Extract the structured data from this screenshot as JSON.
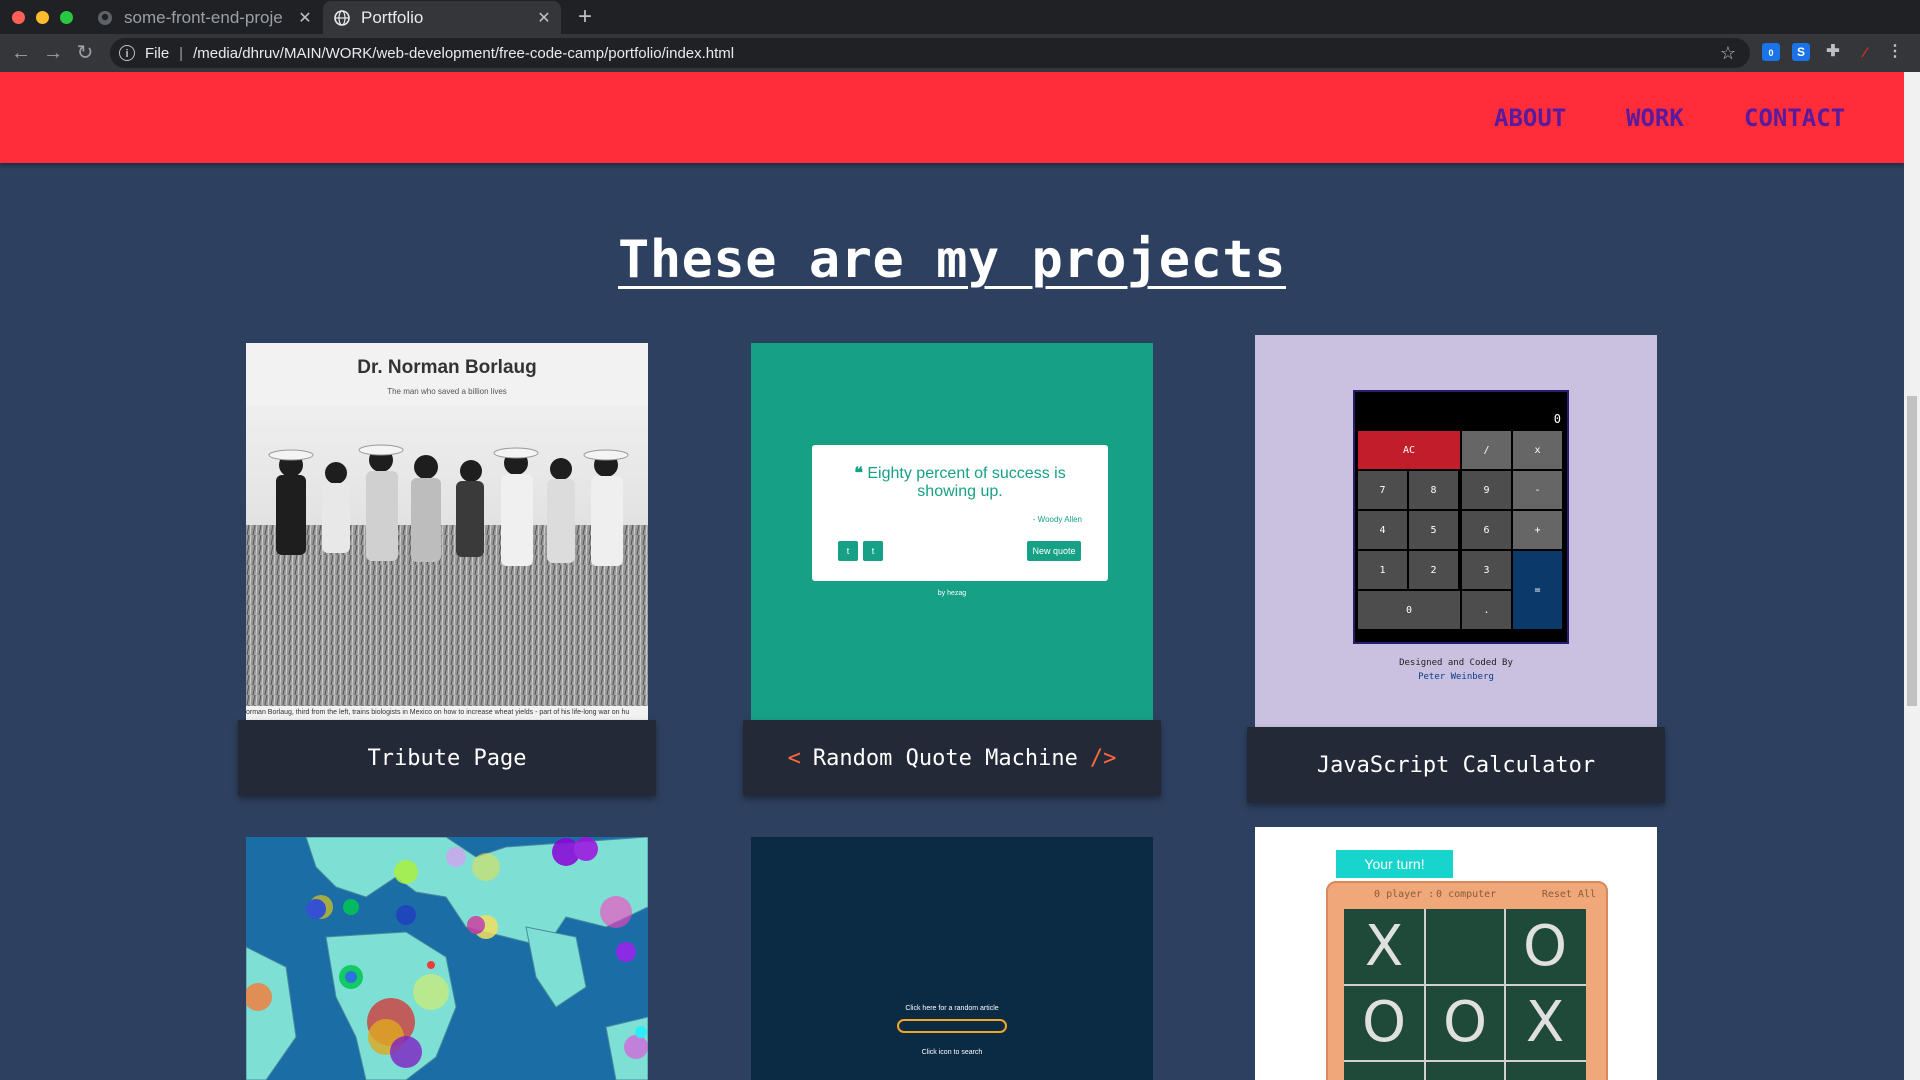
{
  "browser": {
    "tabs": [
      {
        "title": "some-front-end-proje",
        "active": false
      },
      {
        "title": "Portfolio",
        "active": true
      }
    ],
    "new_tab_label": "+",
    "url_scheme": "File",
    "url": "/media/dhruv/MAIN/WORK/web-development/free-code-camp/portfolio/index.html",
    "extension_badge": "0"
  },
  "nav": {
    "links": [
      "ABOUT",
      "WORK",
      "CONTACT"
    ]
  },
  "heading": "These are my projects",
  "projects": [
    {
      "title": "Tribute Page",
      "thumb": {
        "title": "Dr. Norman Borlaug",
        "subtitle": "The man who saved a billion lives",
        "caption": "orman Borlaug, third from the left, trains biologists in Mexico on how to increase wheat yields - part of his life-long war on hu"
      }
    },
    {
      "title": "Random Quote Machine",
      "title_prefix": "<",
      "title_suffix": "/>",
      "thumb": {
        "quote": "Eighty percent of success is showing up.",
        "author": "- Woody Allen",
        "twitter": "t",
        "tumblr": "t",
        "new_quote": "New quote",
        "by": "by hezag"
      }
    },
    {
      "title": "JavaScript Calculator",
      "thumb": {
        "display": "0",
        "keys": [
          "AC",
          "/",
          "x",
          "7",
          "8",
          "9",
          "-",
          "4",
          "5",
          "6",
          "+",
          "1",
          "2",
          "3",
          "=",
          "0",
          "."
        ],
        "credit_line": "Designed and Coded By",
        "credit_name": "Peter Weinberg"
      }
    },
    {
      "title": "",
      "thumb": {}
    },
    {
      "title": "",
      "thumb": {
        "random_text": "Click here for a random article",
        "search_text": "Click icon to search"
      }
    },
    {
      "title": "",
      "thumb": {
        "turn": "Your turn!",
        "player": "player :",
        "player_score": "0",
        "computer": "computer",
        "computer_score": "0",
        "reset": "Reset All",
        "cells": [
          "X",
          "",
          "O",
          "O",
          "O",
          "X"
        ]
      }
    }
  ],
  "colors": {
    "navbar": "#ff2d3a",
    "nav_link": "#5a1a9e",
    "page_bg": "#2d405f",
    "caption_bg": "#232937",
    "quote_green": "#16a085",
    "calc_bg": "#c9c1df",
    "calc_ac": "#c21d2a",
    "calc_equals": "#0b3a6a"
  }
}
